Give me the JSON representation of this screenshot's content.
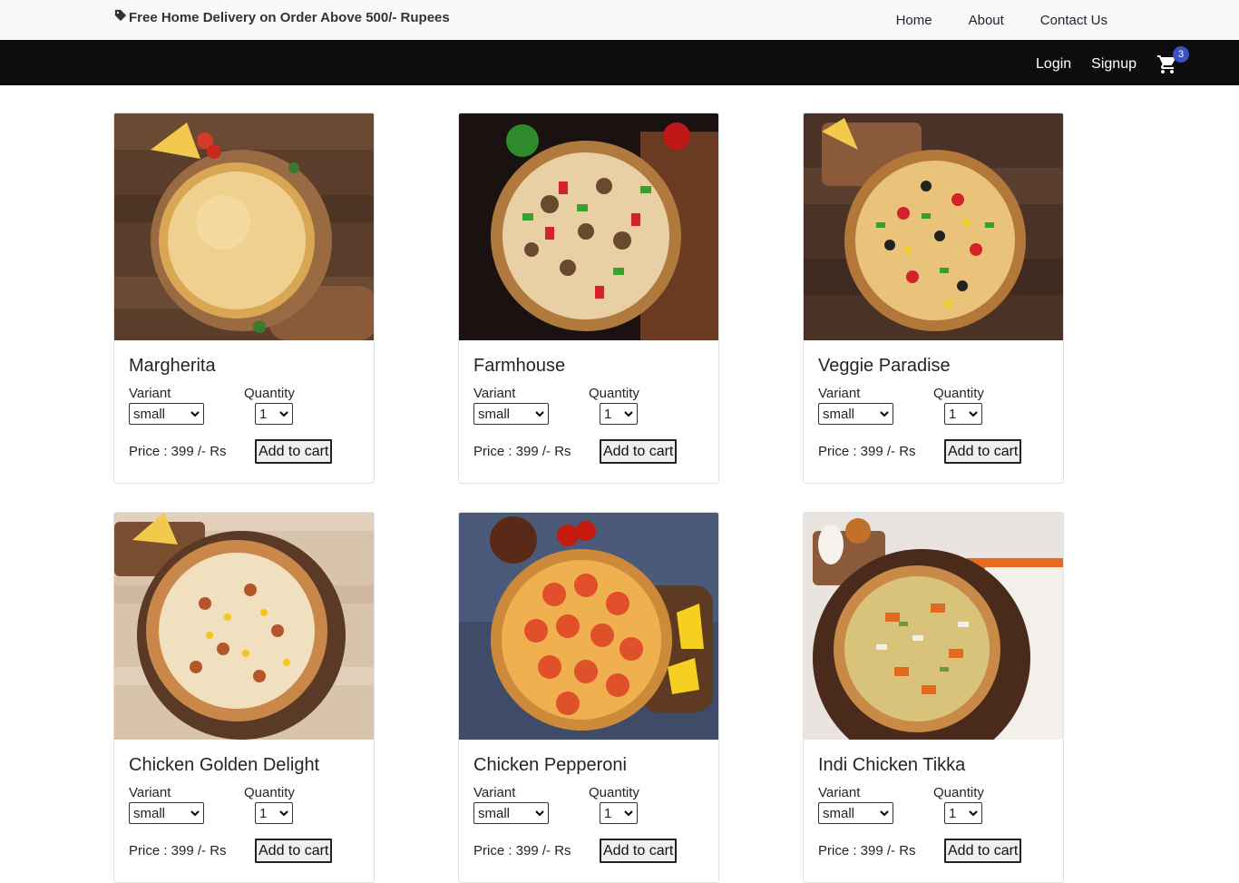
{
  "topbar": {
    "promo": "Free Home Delivery on Order Above 500/- Rupees",
    "nav": [
      "Home",
      "About",
      "Contact Us"
    ]
  },
  "navbar": {
    "login": "Login",
    "signup": "Signup",
    "cart_count": "3"
  },
  "labels": {
    "variant": "Variant",
    "quantity": "Quantity",
    "add_to_cart": "Add to cart"
  },
  "products": [
    {
      "name": "Margherita",
      "variant": "small",
      "quantity": "1",
      "price": "Price : 399 /- Rs"
    },
    {
      "name": "Farmhouse",
      "variant": "small",
      "quantity": "1",
      "price": "Price : 399 /- Rs"
    },
    {
      "name": "Veggie Paradise",
      "variant": "small",
      "quantity": "1",
      "price": "Price : 399 /- Rs"
    },
    {
      "name": "Chicken Golden Delight",
      "variant": "small",
      "quantity": "1",
      "price": "Price : 399 /- Rs"
    },
    {
      "name": "Chicken Pepperoni",
      "variant": "small",
      "quantity": "1",
      "price": "Price : 399 /- Rs"
    },
    {
      "name": "Indi Chicken Tikka",
      "variant": "small",
      "quantity": "1",
      "price": "Price : 399 /- Rs"
    }
  ],
  "colors": {
    "topbar_bg": "#f8f9fa",
    "navbar_bg": "#0d0d0d",
    "badge_bg": "#3b50c4"
  },
  "icons": [
    "tag-icon",
    "cart-icon",
    "chevron-down-icon"
  ]
}
